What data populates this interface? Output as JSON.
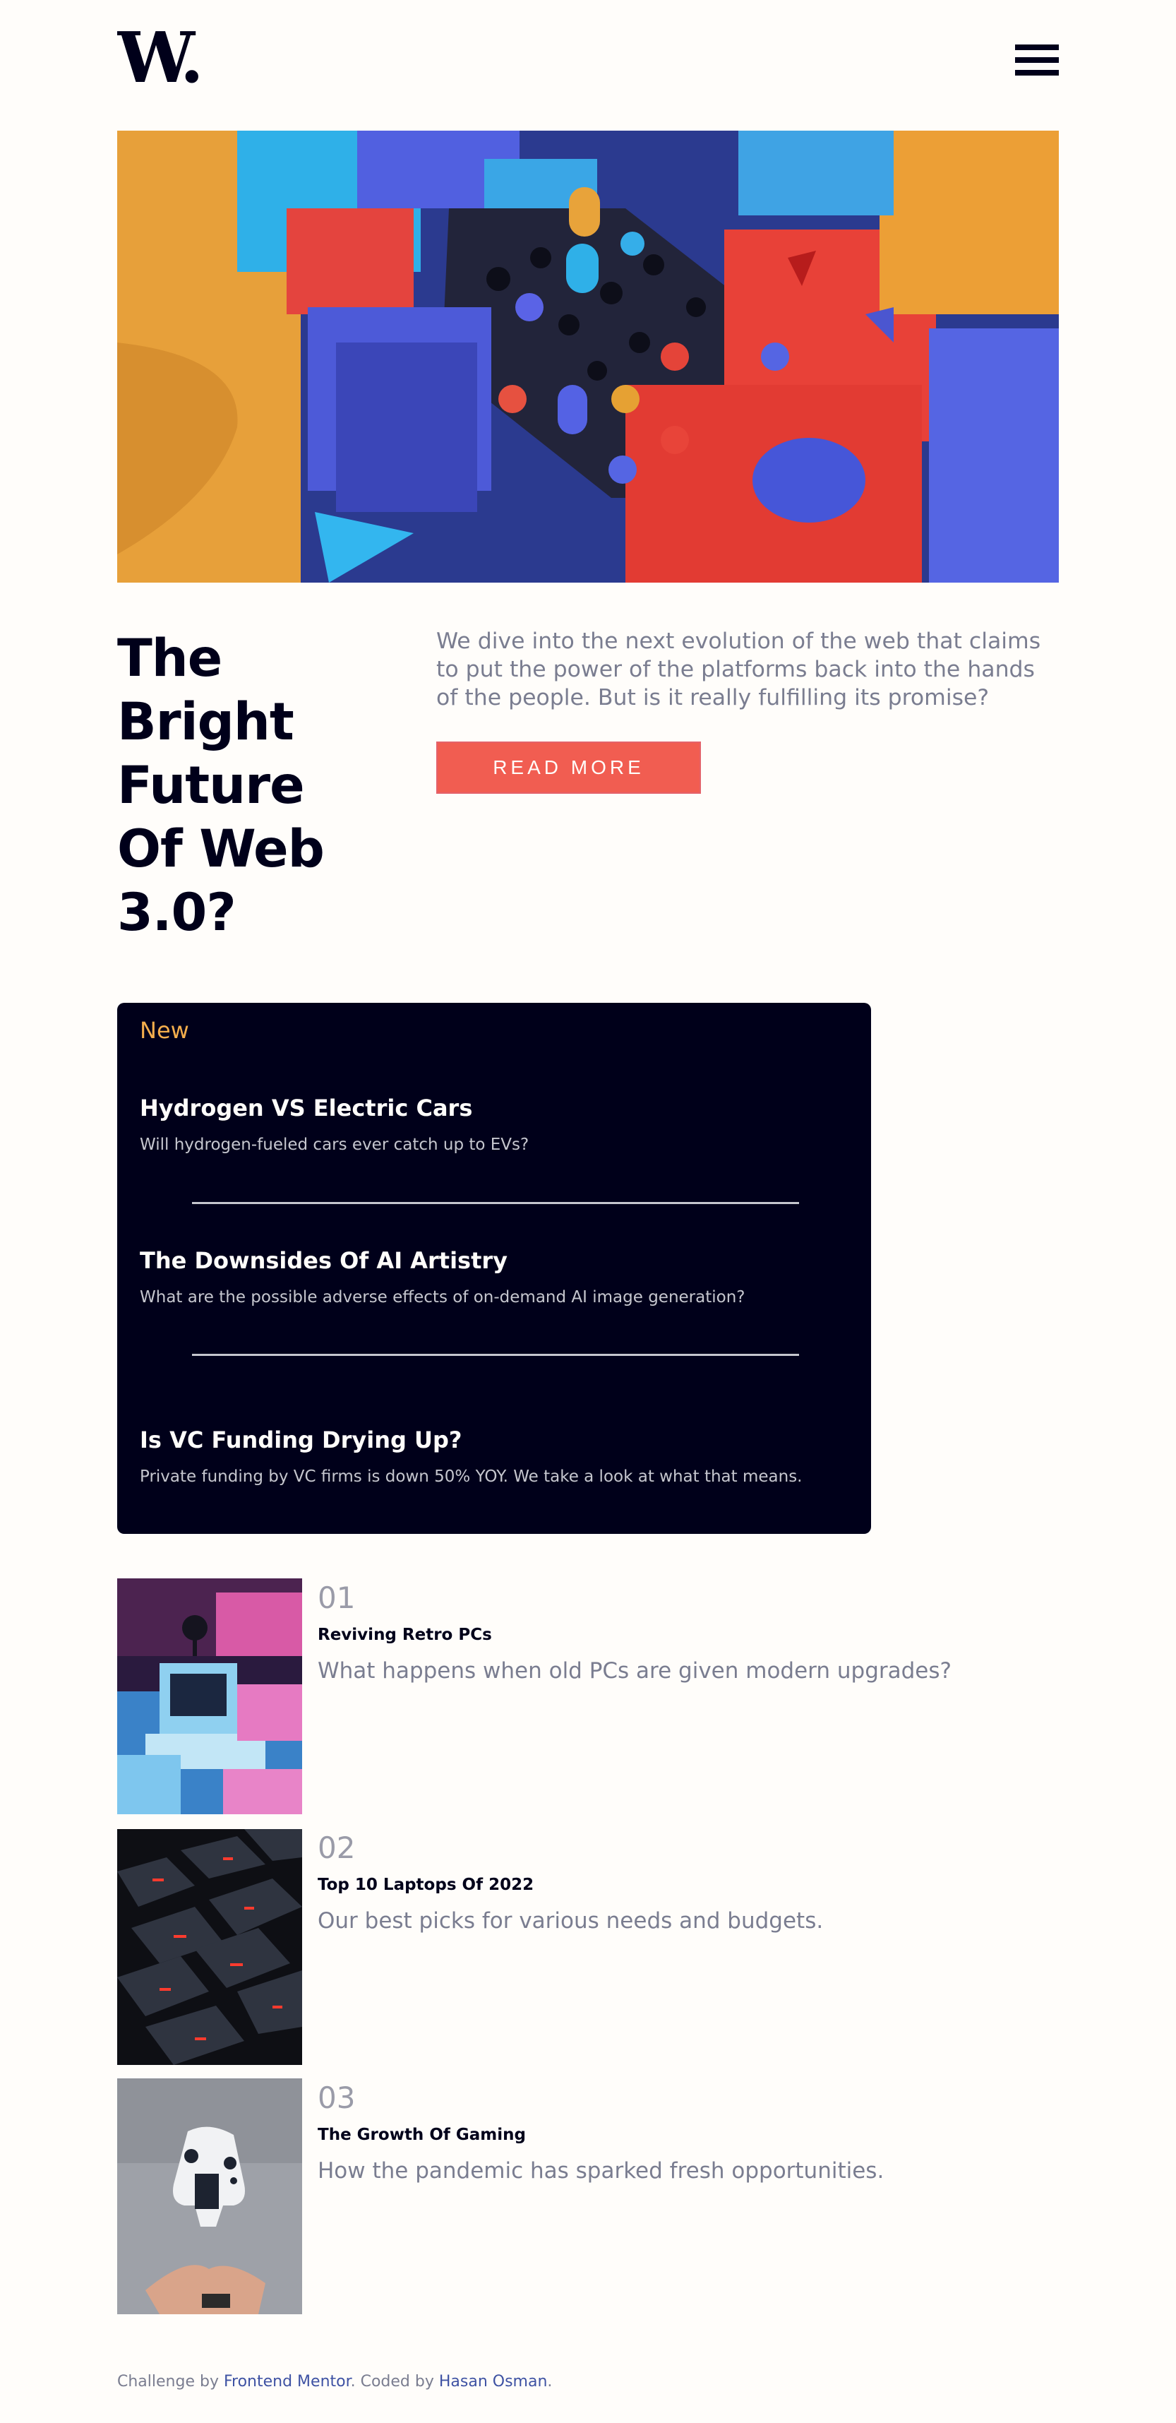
{
  "header": {
    "logo_text": "W.",
    "menu_icon": "hamburger-menu-icon"
  },
  "hero": {
    "headline": "The Bright Future Of Web 3.0?",
    "intro": "We dive into the next evolution of the web that claims to put the power of the platforms back into the hands of the people. But is it really fulfilling its promise?",
    "read_more_label": "READ MORE"
  },
  "new_panel": {
    "title": "New",
    "items": [
      {
        "title": "Hydrogen VS Electric Cars",
        "desc": "Will hydrogen-fueled cars ever catch up to EVs?"
      },
      {
        "title": "The Downsides Of AI Artistry",
        "desc": "What are the possible adverse effects of on-demand AI image generation?"
      },
      {
        "title": "Is VC Funding Drying Up?",
        "desc": "Private funding by VC firms is down 50% YOY. We take a look at what that means."
      }
    ]
  },
  "stray_text": ";",
  "articles": [
    {
      "number": "01",
      "title": "Reviving Retro PCs",
      "desc": "What happens when old PCs are given modern upgrades?"
    },
    {
      "number": "02",
      "title": "Top 10 Laptops Of 2022",
      "desc": "Our best picks for various needs and budgets."
    },
    {
      "number": "03",
      "title": "The Growth Of Gaming",
      "desc": "How the pandemic has sparked fresh opportunities."
    }
  ],
  "footer": {
    "prefix": "Challenge by ",
    "link1": "Frontend Mentor",
    "middle": ". Coded by ",
    "link2": "Hasan Osman",
    "suffix": "."
  },
  "colors": {
    "background": "#fffdfa",
    "dark": "#00001a",
    "accent_red": "#f15d51",
    "accent_orange": "#f4ae4d",
    "grey_text": "#7a7d90",
    "link_blue": "#3e52a3"
  }
}
